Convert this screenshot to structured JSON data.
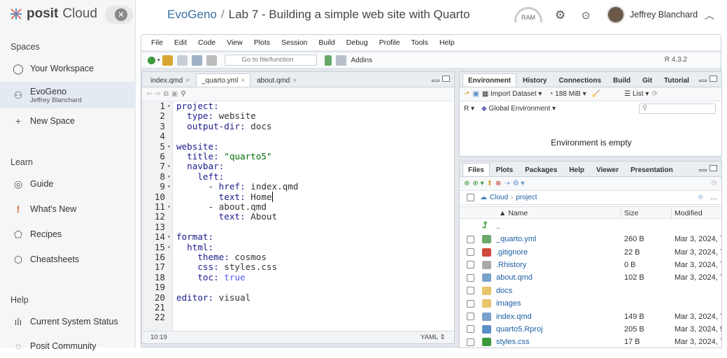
{
  "posit": {
    "brand_a": "posit",
    "brand_b": "Cloud",
    "close": "✕"
  },
  "sidebar": {
    "spaces_heading": "Spaces",
    "workspace": "Your Workspace",
    "space_name": "EvoGeno",
    "space_owner": "Jeffrey Blanchard",
    "new_space": "New Space",
    "learn_heading": "Learn",
    "guide": "Guide",
    "whats_new": "What's New",
    "recipes": "Recipes",
    "cheatsheets": "Cheatsheets",
    "help_heading": "Help",
    "status": "Current System Status",
    "community": "Posit Community"
  },
  "header": {
    "workspace": "EvoGeno",
    "separator": "/",
    "project": "Lab 7 - Building a simple web site with Quarto",
    "ram": "RAM",
    "user": "Jeffrey Blanchard"
  },
  "menu": [
    "File",
    "Edit",
    "Code",
    "View",
    "Plots",
    "Session",
    "Build",
    "Debug",
    "Profile",
    "Tools",
    "Help"
  ],
  "toolbar": {
    "goto_placeholder": "Go to file/function",
    "addins": "Addins",
    "r_version": "R 4.3.2"
  },
  "editor": {
    "tabs": [
      "index.qmd",
      "_quarto.yml",
      "about.qmd"
    ],
    "active_tab": 1,
    "cursor": "10:19",
    "language": "YAML"
  },
  "env": {
    "tabs": [
      "Environment",
      "History",
      "Connections",
      "Build",
      "Git",
      "Tutorial"
    ],
    "import": "Import Dataset",
    "memory": "188 MiB",
    "list": "List",
    "r_lang": "R",
    "scope": "Global Environment",
    "empty": "Environment is empty"
  },
  "files": {
    "tabs": [
      "Files",
      "Plots",
      "Packages",
      "Help",
      "Viewer",
      "Presentation"
    ],
    "crumb_root": "Cloud",
    "crumb_dir": "project",
    "col_name": "Name",
    "col_size": "Size",
    "col_modified": "Modified",
    "up": "..",
    "rows": [
      {
        "name": "_quarto.yml",
        "size": "260 B",
        "modified": "Mar 3, 2024, 7",
        "icon": "yml-icon"
      },
      {
        "name": ".gitignore",
        "size": "22 B",
        "modified": "Mar 3, 2024, 7",
        "icon": "git-icon"
      },
      {
        "name": ".Rhistory",
        "size": "0 B",
        "modified": "Mar 3, 2024, 7",
        "icon": "history-icon"
      },
      {
        "name": "about.qmd",
        "size": "102 B",
        "modified": "Mar 3, 2024, 7",
        "icon": "qmd-icon"
      },
      {
        "name": "docs",
        "size": "",
        "modified": "",
        "icon": "folder-icon"
      },
      {
        "name": "images",
        "size": "",
        "modified": "",
        "icon": "folder-icon"
      },
      {
        "name": "index.qmd",
        "size": "149 B",
        "modified": "Mar 3, 2024, 7",
        "icon": "qmd-icon"
      },
      {
        "name": "quarto5.Rproj",
        "size": "205 B",
        "modified": "Mar 3, 2024, 9",
        "icon": "rproj-icon"
      },
      {
        "name": "styles.css",
        "size": "17 B",
        "modified": "Mar 3, 2024, 7",
        "icon": "css-icon"
      }
    ]
  },
  "code_lines": [
    {
      "n": "1",
      "f": "▾",
      "segs": [
        [
          "k",
          "project:"
        ]
      ]
    },
    {
      "n": "2",
      "f": "",
      "segs": [
        [
          "",
          "  "
        ],
        [
          "k",
          "type:"
        ],
        [
          "",
          " website"
        ]
      ]
    },
    {
      "n": "3",
      "f": "",
      "segs": [
        [
          "",
          "  "
        ],
        [
          "k",
          "output-dir:"
        ],
        [
          "",
          " docs"
        ]
      ]
    },
    {
      "n": "4",
      "f": "",
      "segs": []
    },
    {
      "n": "5",
      "f": "▾",
      "segs": [
        [
          "k",
          "website:"
        ]
      ]
    },
    {
      "n": "6",
      "f": "",
      "segs": [
        [
          "",
          "  "
        ],
        [
          "k",
          "title:"
        ],
        [
          "",
          " "
        ],
        [
          "s",
          "\"quarto5\""
        ]
      ]
    },
    {
      "n": "7",
      "f": "▾",
      "segs": [
        [
          "",
          "  "
        ],
        [
          "k",
          "navbar:"
        ]
      ]
    },
    {
      "n": "8",
      "f": "▾",
      "segs": [
        [
          "",
          "    "
        ],
        [
          "k",
          "left:"
        ]
      ]
    },
    {
      "n": "9",
      "f": "▾",
      "segs": [
        [
          "",
          "      - "
        ],
        [
          "k",
          "href:"
        ],
        [
          "",
          " index.qmd"
        ]
      ]
    },
    {
      "n": "10",
      "f": "",
      "segs": [
        [
          "",
          "        "
        ],
        [
          "k",
          "text:"
        ],
        [
          "",
          " Home"
        ]
      ]
    },
    {
      "n": "11",
      "f": "▾",
      "segs": [
        [
          "",
          "      - about.qmd"
        ]
      ]
    },
    {
      "n": "12",
      "f": "",
      "segs": [
        [
          "",
          "        "
        ],
        [
          "k",
          "text:"
        ],
        [
          "",
          " About"
        ]
      ]
    },
    {
      "n": "13",
      "f": "",
      "segs": []
    },
    {
      "n": "14",
      "f": "▾",
      "segs": [
        [
          "k",
          "format:"
        ]
      ]
    },
    {
      "n": "15",
      "f": "▾",
      "segs": [
        [
          "",
          "  "
        ],
        [
          "k",
          "html:"
        ]
      ]
    },
    {
      "n": "16",
      "f": "",
      "segs": [
        [
          "",
          "    "
        ],
        [
          "k",
          "theme:"
        ],
        [
          "",
          " cosmos"
        ]
      ]
    },
    {
      "n": "17",
      "f": "",
      "segs": [
        [
          "",
          "    "
        ],
        [
          "k",
          "css:"
        ],
        [
          "",
          " styles.css"
        ]
      ]
    },
    {
      "n": "18",
      "f": "",
      "segs": [
        [
          "",
          "    "
        ],
        [
          "k",
          "toc:"
        ],
        [
          "",
          " "
        ],
        [
          "v",
          "true"
        ]
      ]
    },
    {
      "n": "19",
      "f": "",
      "segs": []
    },
    {
      "n": "20",
      "f": "",
      "segs": [
        [
          "k",
          "editor:"
        ],
        [
          "",
          " visual"
        ]
      ]
    },
    {
      "n": "21",
      "f": "",
      "segs": []
    },
    {
      "n": "22",
      "f": "",
      "segs": []
    }
  ]
}
